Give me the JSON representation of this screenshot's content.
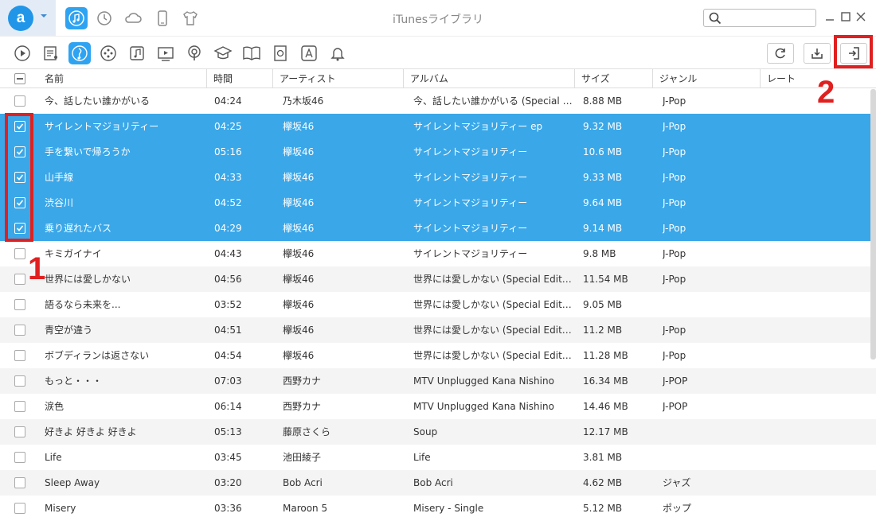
{
  "app": {
    "title": "iTunesライブラリ",
    "logo_letter": "a",
    "accent_color": "#2ea3f2",
    "selection_color": "#3aa7e8",
    "annotation_color": "#e02020"
  },
  "top_nav": {
    "icons": [
      "music-icon",
      "history-icon",
      "cloud-icon",
      "phone-icon",
      "tshirt-icon"
    ],
    "active": "music-icon"
  },
  "search": {
    "value": "",
    "placeholder": ""
  },
  "window_controls": [
    "minimize-icon",
    "maximize-icon",
    "close-icon"
  ],
  "category_toolbar": {
    "icons": [
      "play-icon",
      "playlist-icon",
      "music-note-icon",
      "ringtone-icon",
      "music-video-icon",
      "tv-icon",
      "podcast-icon",
      "itunes-u-icon",
      "book-icon",
      "audiobook-icon",
      "app-store-icon",
      "bell-icon"
    ],
    "active": "music-note-icon"
  },
  "actions": [
    "refresh-icon",
    "import-icon",
    "export-to-device-icon"
  ],
  "table": {
    "columns": [
      "名前",
      "時間",
      "アーティスト",
      "アルバム",
      "サイズ",
      "ジャンル",
      "レート"
    ],
    "rows": [
      {
        "name": "今、話したい誰かがいる",
        "time": "04:24",
        "artist": "乃木坂46",
        "album": "今、話したい誰かがいる (Special Editi...",
        "size": "8.88 MB",
        "genre": "J-Pop",
        "selected": false
      },
      {
        "name": "サイレントマジョリティー",
        "time": "04:25",
        "artist": "欅坂46",
        "album": "サイレントマジョリティー ep",
        "size": "9.32 MB",
        "genre": "J-Pop",
        "selected": true
      },
      {
        "name": "手を繋いで帰ろうか",
        "time": "05:16",
        "artist": "欅坂46",
        "album": "サイレントマジョリティー",
        "size": "10.6 MB",
        "genre": "J-Pop",
        "selected": true
      },
      {
        "name": "山手線",
        "time": "04:33",
        "artist": "欅坂46",
        "album": "サイレントマジョリティー",
        "size": "9.33 MB",
        "genre": "J-Pop",
        "selected": true
      },
      {
        "name": "渋谷川",
        "time": "04:52",
        "artist": "欅坂46",
        "album": "サイレントマジョリティー",
        "size": "9.64 MB",
        "genre": "J-Pop",
        "selected": true
      },
      {
        "name": "乗り遅れたバス",
        "time": "04:29",
        "artist": "欅坂46",
        "album": "サイレントマジョリティー",
        "size": "9.14 MB",
        "genre": "J-Pop",
        "selected": true
      },
      {
        "name": "キミガイナイ",
        "time": "04:43",
        "artist": "欅坂46",
        "album": "サイレントマジョリティー",
        "size": "9.8 MB",
        "genre": "J-Pop",
        "selected": false
      },
      {
        "name": "世界には愛しかない",
        "time": "04:56",
        "artist": "欅坂46",
        "album": "世界には愛しかない (Special Edition)",
        "size": "11.54 MB",
        "genre": "J-Pop",
        "selected": false
      },
      {
        "name": "語るなら未来を...",
        "time": "03:52",
        "artist": "欅坂46",
        "album": "世界には愛しかない (Special Edition)",
        "size": "9.05 MB",
        "genre": "",
        "selected": false
      },
      {
        "name": "青空が違う",
        "time": "04:51",
        "artist": "欅坂46",
        "album": "世界には愛しかない (Special Edition)",
        "size": "11.2 MB",
        "genre": "J-Pop",
        "selected": false
      },
      {
        "name": "ボブディランは返さない",
        "time": "04:54",
        "artist": "欅坂46",
        "album": "世界には愛しかない (Special Edition)",
        "size": "11.28 MB",
        "genre": "J-Pop",
        "selected": false
      },
      {
        "name": "もっと・・・",
        "time": "07:03",
        "artist": "西野カナ",
        "album": "MTV Unplugged Kana Nishino",
        "size": "16.34 MB",
        "genre": "J-POP",
        "selected": false
      },
      {
        "name": "涙色",
        "time": "06:14",
        "artist": "西野カナ",
        "album": "MTV Unplugged Kana Nishino",
        "size": "14.46 MB",
        "genre": "J-POP",
        "selected": false
      },
      {
        "name": "好きよ 好きよ 好きよ",
        "time": "05:13",
        "artist": "藤原さくら",
        "album": "Soup",
        "size": "12.17 MB",
        "genre": "",
        "selected": false
      },
      {
        "name": "Life",
        "time": "03:45",
        "artist": "池田綾子",
        "album": "Life",
        "size": "3.81 MB",
        "genre": "",
        "selected": false
      },
      {
        "name": "Sleep Away",
        "time": "03:20",
        "artist": "Bob Acri",
        "album": "Bob Acri",
        "size": "4.62 MB",
        "genre": "ジャズ",
        "selected": false
      },
      {
        "name": "Misery",
        "time": "03:36",
        "artist": "Maroon 5",
        "album": "Misery - Single",
        "size": "5.12 MB",
        "genre": "ポップ",
        "selected": false
      }
    ]
  },
  "annotations": {
    "step1": "1",
    "step2": "2"
  }
}
